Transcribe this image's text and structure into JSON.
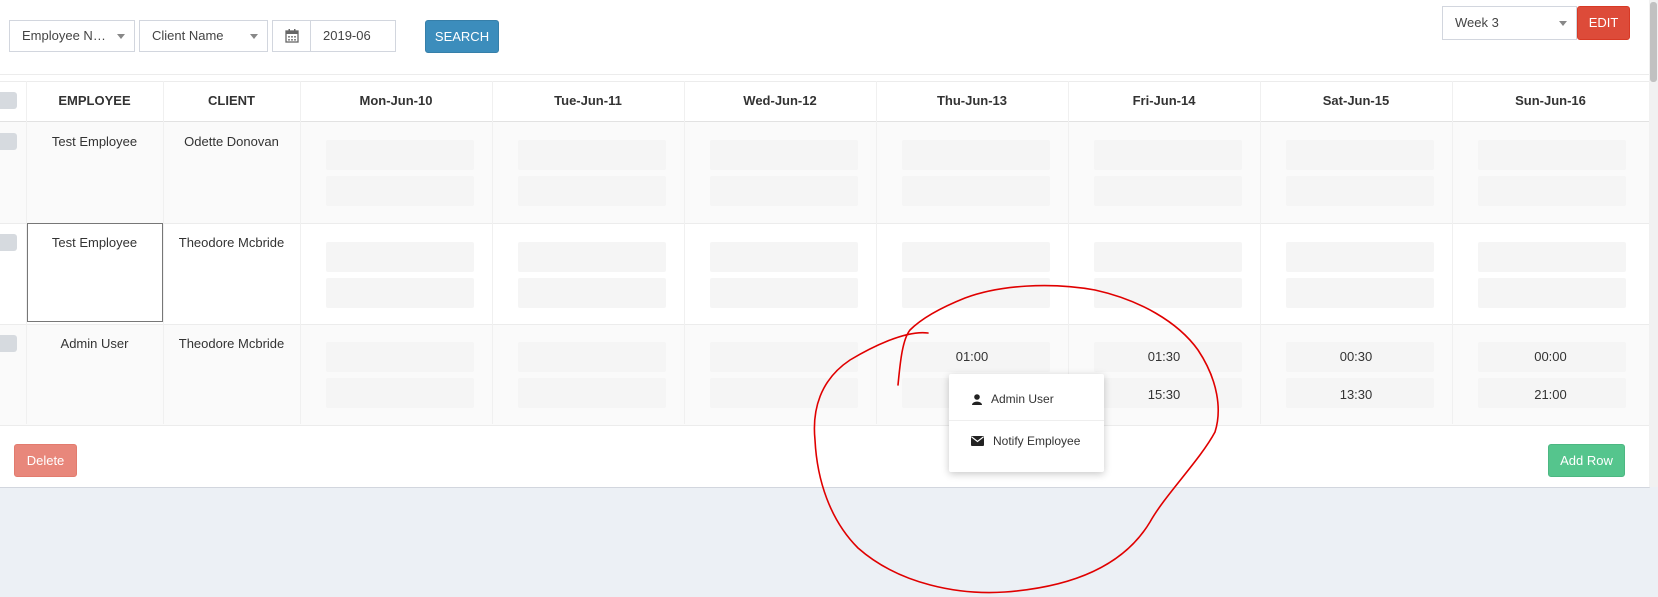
{
  "toolbar": {
    "employee_filter": "Employee Na...",
    "client_filter": "Client Name",
    "date_value": "2019-06",
    "search_label": "SEARCH",
    "week_select": "Week 3",
    "edit_label": "EDIT"
  },
  "table": {
    "headers": [
      "EMPLOYEE",
      "CLIENT",
      "Mon-Jun-10",
      "Tue-Jun-11",
      "Wed-Jun-12",
      "Thu-Jun-13",
      "Fri-Jun-14",
      "Sat-Jun-15",
      "Sun-Jun-16"
    ],
    "rows": [
      {
        "employee": "Test Employee",
        "client": "Odette Donovan"
      },
      {
        "employee": "Test Employee",
        "client": "Theodore Mcbride"
      },
      {
        "employee": "Admin User",
        "client": "Theodore Mcbride",
        "times": {
          "thu": [
            "01:00",
            ""
          ],
          "fri": [
            "01:30",
            "15:30"
          ],
          "sat": [
            "00:30",
            "13:30"
          ],
          "sun": [
            "00:00",
            "21:00"
          ]
        }
      }
    ]
  },
  "context_menu": {
    "items": [
      {
        "label": "Admin User",
        "icon": "user-icon"
      },
      {
        "label": "Notify Employee",
        "icon": "envelope-icon"
      }
    ]
  },
  "footer": {
    "delete_label": "Delete",
    "add_row_label": "Add Row"
  },
  "colors": {
    "search": "#3c8dbc",
    "edit": "#dd4b39",
    "delete": "#e8877b",
    "add_row": "#55c58d",
    "annotation": "#e00000"
  }
}
